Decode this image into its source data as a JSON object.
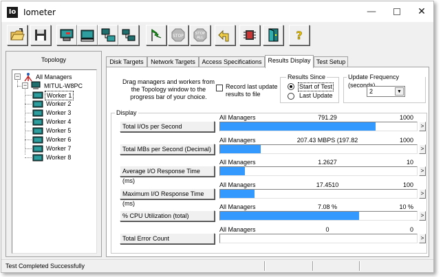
{
  "window": {
    "title": "Iometer",
    "app_icon_text": "Io",
    "minimize_glyph": "—",
    "close_glyph": "✕"
  },
  "toolbar": {
    "buttons": [
      {
        "name": "open-config-button",
        "icon": "open-folder-icon"
      },
      {
        "name": "save-config-button",
        "icon": "floppy-disk-icon"
      },
      {
        "name": "new-disk-worker-button",
        "icon": "disk-worker-icon"
      },
      {
        "name": "new-network-worker-button",
        "icon": "network-worker-icon"
      },
      {
        "name": "duplicate-worker-button",
        "icon": "duplicate-worker-icon"
      },
      {
        "name": "add-manager-button",
        "icon": "network-computers-icon"
      },
      {
        "name": "start-tests-button",
        "icon": "green-flag-icon"
      },
      {
        "name": "stop-button",
        "icon": "stop-sign-icon"
      },
      {
        "name": "stop-all-button",
        "icon": "stop-all-sign-icon"
      },
      {
        "name": "reset-workers-button",
        "icon": "reset-arrow-icon"
      },
      {
        "name": "disconnect-button",
        "icon": "disconnect-icon"
      },
      {
        "name": "exit-button",
        "icon": "exit-door-icon"
      },
      {
        "name": "about-button",
        "icon": "question-mark-icon"
      }
    ],
    "stop_label": "STOP",
    "stop_all_label_top": "STOP",
    "stop_all_label_bottom": "ALL",
    "help_glyph": "?"
  },
  "topology": {
    "title": "Topology",
    "root": "All Managers",
    "manager": "MITUL-W8PC",
    "workers": [
      "Worker 1",
      "Worker 2",
      "Worker 3",
      "Worker 4",
      "Worker 5",
      "Worker 6",
      "Worker 7",
      "Worker 8"
    ],
    "selected_worker": "Worker 1",
    "expand_glyph": "−"
  },
  "tabs": [
    {
      "label": "Disk Targets",
      "active": false
    },
    {
      "label": "Network Targets",
      "active": false
    },
    {
      "label": "Access Specifications",
      "active": false
    },
    {
      "label": "Results Display",
      "active": true
    },
    {
      "label": "Test Setup",
      "active": false
    }
  ],
  "results_display": {
    "drag_hint": "Drag managers and workers from the Topology window to the progress bar of your choice.",
    "record_last_update": {
      "label": "Record last update results to file",
      "checked": false
    },
    "results_since": {
      "title": "Results Since",
      "options": [
        "Start of Test",
        "Last Update"
      ],
      "selected": "Start of Test"
    },
    "update_frequency": {
      "title": "Update Frequency (seconds)",
      "value": "2",
      "arrow_glyph": "▼"
    },
    "display_group_title": "Display",
    "more_glyph": ">",
    "metrics": [
      {
        "label": "Total I/Os per Second",
        "source": "All Managers",
        "value": "791.29",
        "max": "1000",
        "fraction": 0.7913
      },
      {
        "label": "Total MBs per Second (Decimal)",
        "source": "All Managers",
        "value": "207.43 MBPS (197.82 MiBPS)",
        "max": "1000",
        "fraction": 0.2074
      },
      {
        "label": "Average I/O Response Time (ms)",
        "source": "All Managers",
        "value": "1.2627",
        "max": "10",
        "fraction": 0.1263
      },
      {
        "label": "Maximum I/O Response Time (ms)",
        "source": "All Managers",
        "value": "17.4510",
        "max": "100",
        "fraction": 0.1745
      },
      {
        "label": "% CPU Utilization (total)",
        "source": "All Managers",
        "value": "7.08 %",
        "max": "10 %",
        "fraction": 0.708
      },
      {
        "label": "Total Error Count",
        "source": "All Managers",
        "value": "0",
        "max": "0",
        "fraction": 0
      }
    ]
  },
  "status": {
    "text": "Test Completed Successfully"
  },
  "colors": {
    "progress_fill": "#3399ff",
    "window_background": "#f0f0f0"
  }
}
